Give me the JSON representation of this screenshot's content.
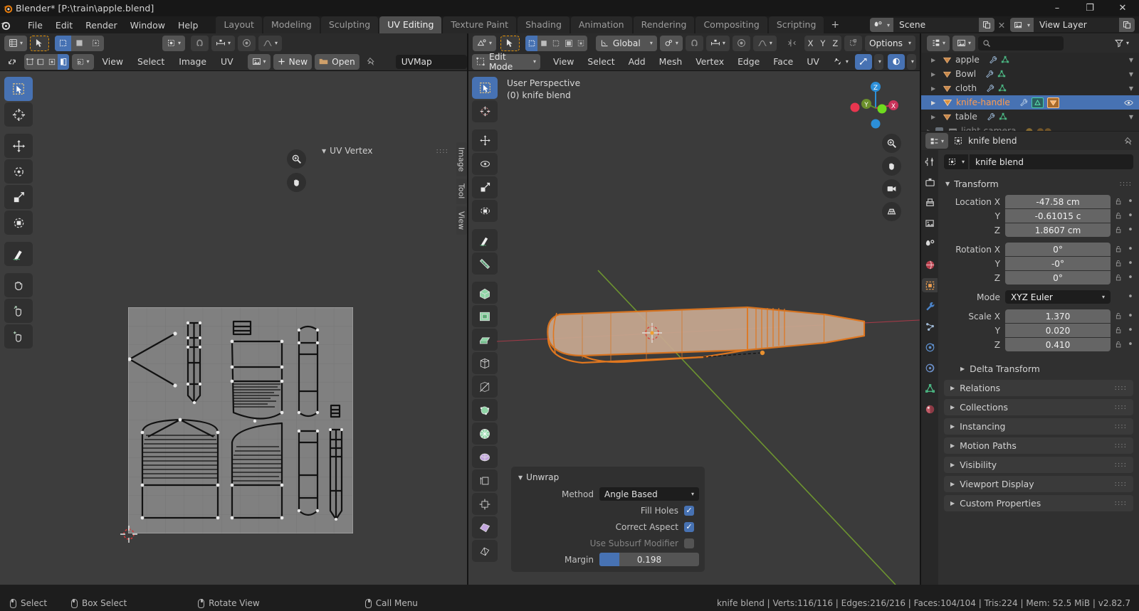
{
  "titlebar": {
    "title": "Blender* [P:\\train\\apple.blend]",
    "minimize": "–",
    "maximize": "❐",
    "close": "✕"
  },
  "topbar": {
    "menus": [
      "File",
      "Edit",
      "Render",
      "Window",
      "Help"
    ],
    "workspaces": [
      "Layout",
      "Modeling",
      "Sculpting",
      "UV Editing",
      "Texture Paint",
      "Shading",
      "Animation",
      "Rendering",
      "Compositing",
      "Scripting"
    ],
    "active_workspace": "UV Editing",
    "add_workspace": "+",
    "scene_name": "Scene",
    "view_layer_name": "View Layer",
    "scene_close": "✕"
  },
  "uv_editor": {
    "header_menus": [
      "View",
      "Select",
      "Image",
      "UV"
    ],
    "new_button": "New",
    "open_button": "Open",
    "image_name": "UVMap",
    "panel_title": "UV Vertex",
    "side_tabs": [
      "Image",
      "Tool",
      "View"
    ],
    "tools": [
      "tweak-tool",
      "cursor-tool",
      "move-tool",
      "rotate-tool",
      "scale-tool",
      "transform-tool",
      "annotate-tool",
      "grab-uv-tool",
      "relax-uv-tool",
      "pinch-uv-tool"
    ]
  },
  "viewport": {
    "mode": "Edit Mode",
    "transform_orientation": "Global",
    "options_label": "Options",
    "axis_buttons": [
      "X",
      "Y",
      "Z"
    ],
    "header_menus": [
      "View",
      "Select",
      "Add",
      "Mesh",
      "Vertex",
      "Edge",
      "Face",
      "UV"
    ],
    "overlay_text_line1": "User Perspective",
    "overlay_text_line2": "(0) knife blend",
    "gizmo_axes": [
      "X",
      "Y",
      "Z"
    ],
    "operator_panel": {
      "title": "Unwrap",
      "method_label": "Method",
      "method_value": "Angle Based",
      "fill_holes_label": "Fill Holes",
      "fill_holes_checked": true,
      "correct_aspect_label": "Correct Aspect",
      "correct_aspect_checked": true,
      "use_subsurf_label": "Use Subsurf Modifier",
      "use_subsurf_checked": false,
      "margin_label": "Margin",
      "margin_value": "0.198",
      "margin_fill_percent": 19.8
    }
  },
  "outliner": {
    "search_placeholder": "",
    "rows": [
      {
        "label": "apple",
        "selected": false
      },
      {
        "label": "Bowl",
        "selected": false
      },
      {
        "label": "cloth",
        "selected": false
      },
      {
        "label": "knife-handle",
        "selected": true
      },
      {
        "label": "table",
        "selected": false
      },
      {
        "label": "light-camera",
        "selected": false
      }
    ]
  },
  "properties": {
    "breadcrumb_object": "knife blend",
    "object_name": "knife blend",
    "transform": {
      "title": "Transform",
      "location_label": "Location X",
      "location": [
        {
          "axis": "Location X",
          "value": "-47.58 cm"
        },
        {
          "axis": "Y",
          "value": "-0.61015 c"
        },
        {
          "axis": "Z",
          "value": "1.8607 cm"
        }
      ],
      "rotation": [
        {
          "axis": "Rotation X",
          "value": "0°"
        },
        {
          "axis": "Y",
          "value": "-0°"
        },
        {
          "axis": "Z",
          "value": "0°"
        }
      ],
      "mode_label": "Mode",
      "mode_value": "XYZ Euler",
      "scale": [
        {
          "axis": "Scale X",
          "value": "1.370"
        },
        {
          "axis": "Y",
          "value": "0.020"
        },
        {
          "axis": "Z",
          "value": "0.410"
        }
      ]
    },
    "sub_panel": "Delta Transform",
    "panels": [
      "Relations",
      "Collections",
      "Instancing",
      "Motion Paths",
      "Visibility",
      "Viewport Display",
      "Custom Properties"
    ]
  },
  "statusbar": {
    "hints": [
      {
        "icon": "mouse-left",
        "label": "Select"
      },
      {
        "icon": "mouse-left-drag",
        "label": "Box Select"
      },
      {
        "icon": "mouse-middle",
        "label": "Rotate View"
      },
      {
        "icon": "mouse-right",
        "label": "Call Menu"
      }
    ],
    "stats": "knife blend | Verts:116/116 | Edges:216/216 | Faces:104/104 | Tris:224 | Mem: 52.5 MiB | v2.82.7"
  },
  "colors": {
    "accent": "#4772b3",
    "selected_object": "#ff9b4e",
    "mesh_orange": "#e0771f",
    "header_bg": "#2b2b2b",
    "viewport_bg": "#3b3b3b"
  }
}
